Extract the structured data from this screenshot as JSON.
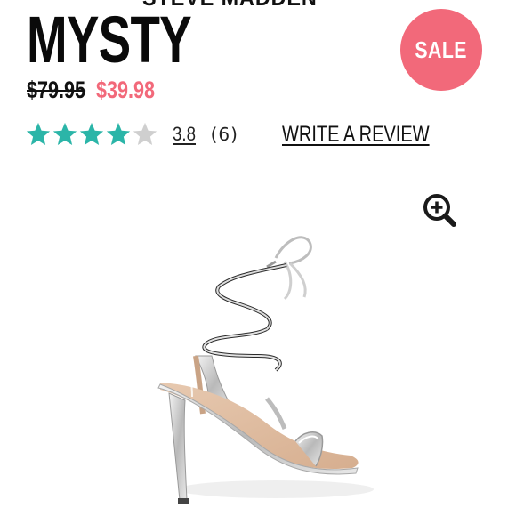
{
  "brand": "STEVE MADDEN",
  "product": {
    "title": "MYSTY",
    "badge": "SALE",
    "price_original": "$79.95",
    "price_sale": "$39.98",
    "rating_value": "3.8",
    "rating_fraction": 0.76,
    "review_count": "(6)",
    "write_review_label": "WRITE A REVIEW"
  },
  "icons": {
    "zoom": "zoom-in-icon",
    "star": "star-icon"
  },
  "colors": {
    "accent_sale": "#f2697a",
    "star_filled": "#2bb5a8",
    "star_empty": "#cfcfcf",
    "text": "#111111"
  }
}
